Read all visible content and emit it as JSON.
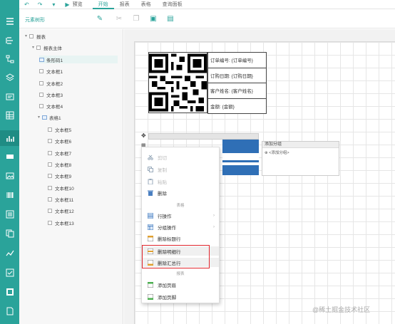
{
  "topbar": {
    "undo_icon": "undo-icon",
    "redo_icon": "redo-icon",
    "save_icon": "save-icon",
    "preview_label": "预览",
    "tabs": [
      {
        "label": "开始",
        "active": true
      },
      {
        "label": "报表",
        "active": false
      },
      {
        "label": "表格",
        "active": false
      },
      {
        "label": "查询面板",
        "active": false
      }
    ]
  },
  "toolbar": {
    "panel_title": "元素树形",
    "icons": [
      "pin-icon",
      "cut-icon",
      "copy-icon",
      "paste-icon",
      "clipboard-icon"
    ]
  },
  "tree": {
    "root": "报表",
    "nodes": [
      {
        "label": "报表主体",
        "level": 1
      },
      {
        "label": "条形码1",
        "level": 2
      },
      {
        "label": "文本框1",
        "level": 2
      },
      {
        "label": "文本框2",
        "level": 2
      },
      {
        "label": "文本框3",
        "level": 2
      },
      {
        "label": "文本框4",
        "level": 2
      },
      {
        "label": "表格1",
        "level": 2
      },
      {
        "label": "文本框5",
        "level": 3
      },
      {
        "label": "文本框6",
        "level": 3
      },
      {
        "label": "文本框7",
        "level": 3
      },
      {
        "label": "文本框8",
        "level": 3
      },
      {
        "label": "文本框9",
        "level": 3
      },
      {
        "label": "文本框10",
        "level": 3
      },
      {
        "label": "文本框11",
        "level": 3
      },
      {
        "label": "文本框12",
        "level": 3
      },
      {
        "label": "文本框13",
        "level": 3
      }
    ]
  },
  "report": {
    "fields": [
      "订单编号: {订单编号}",
      "订购日期: {订购日期}",
      "客户姓名: {客户姓名}",
      "金额: {金额}"
    ],
    "group_panel_title": "添加分组",
    "group_panel_hint": "⊕ <添加分组>"
  },
  "context_menu": {
    "items_top": [
      {
        "label": "剪切",
        "icon": "cut-icon",
        "dim": true
      },
      {
        "label": "复制",
        "icon": "copy-icon",
        "dim": true
      },
      {
        "label": "粘贴",
        "icon": "paste-icon",
        "dim": true
      },
      {
        "label": "删除",
        "icon": "delete-icon",
        "dim": false
      }
    ],
    "section1": "表格",
    "items_mid": [
      {
        "label": "行操作",
        "icon": "row-ops-icon",
        "submenu": true
      },
      {
        "label": "分组操作",
        "icon": "group-ops-icon",
        "submenu": true
      },
      {
        "label": "删除标题行",
        "icon": "delete-header-row-icon",
        "submenu": false
      },
      {
        "label": "删除明细行",
        "icon": "delete-detail-row-icon",
        "submenu": false
      },
      {
        "label": "删除汇总行",
        "icon": "delete-summary-row-icon",
        "submenu": false
      }
    ],
    "section2": "报表",
    "items_bottom": [
      {
        "label": "添加页眉",
        "icon": "add-header-icon"
      },
      {
        "label": "添加页脚",
        "icon": "add-footer-icon"
      }
    ]
  },
  "watermark": "@稀土掘金技术社区"
}
